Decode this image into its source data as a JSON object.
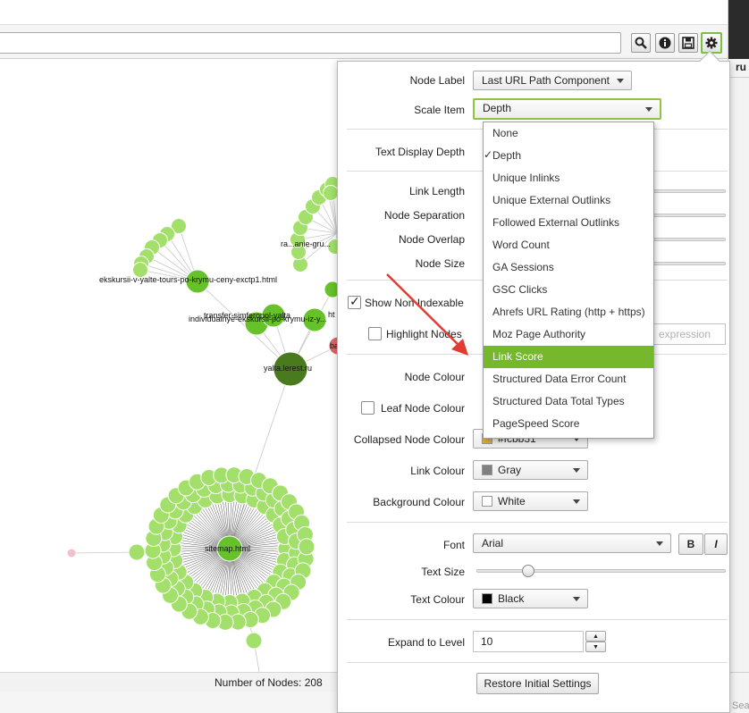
{
  "toolbar": {
    "search_value": "",
    "icons": [
      "search-icon",
      "info-icon",
      "save-icon",
      "gear-icon"
    ]
  },
  "right_strip": {
    "header_text": "ru",
    "search_placeholder": "Search..."
  },
  "graph": {
    "nodes": [
      {
        "label": "ekskursii-v-yalte-tours-po-krymu-ceny-exctp1.html"
      },
      {
        "label": "ra...anie-gru..."
      },
      {
        "label": "transfer-simferopol-yalta"
      },
      {
        "label": "individualnye-ekskursii-po-krymu-iz-y..."
      },
      {
        "label": "ht"
      },
      {
        "label": "ba"
      },
      {
        "label": "yalta.lerest.ru"
      },
      {
        "label": "sitemap.html"
      }
    ]
  },
  "status": {
    "node_count_text": "Number of Nodes: 208"
  },
  "settings": {
    "node_label": {
      "label": "Node Label",
      "value": "Last URL Path Component"
    },
    "scale_item": {
      "label": "Scale Item",
      "value": "Depth"
    },
    "text_display_depth": {
      "label": "Text Display Depth"
    },
    "link_length": {
      "label": "Link Length"
    },
    "node_separation": {
      "label": "Node Separation"
    },
    "node_overlap": {
      "label": "Node Overlap"
    },
    "node_size": {
      "label": "Node Size"
    },
    "show_non_indexable": {
      "label": "Show Non Indexable",
      "checked": true
    },
    "highlight_nodes": {
      "label": "Highlight Nodes",
      "checked": false,
      "placeholder": "expression"
    },
    "node_colour": {
      "label": "Node Colour"
    },
    "leaf_node_colour": {
      "label": "Leaf Node Colour",
      "checked": false
    },
    "collapsed_node_colour": {
      "label": "Collapsed Node Colour",
      "value": "#fcbb31",
      "swatch": "#e0b030"
    },
    "link_colour": {
      "label": "Link Colour",
      "value": "Gray",
      "swatch": "#808080"
    },
    "background_colour": {
      "label": "Background Colour",
      "value": "White",
      "swatch": "#ffffff"
    },
    "font": {
      "label": "Font",
      "value": "Arial",
      "bold": "B",
      "italic": "I"
    },
    "text_size": {
      "label": "Text Size"
    },
    "text_colour": {
      "label": "Text Colour",
      "value": "Black",
      "swatch": "#000000"
    },
    "expand_to_level": {
      "label": "Expand to Level",
      "value": "10"
    },
    "restore_button": "Restore Initial Settings"
  },
  "scale_dropdown": {
    "options": [
      "None",
      "Depth",
      "Unique Inlinks",
      "Unique External Outlinks",
      "Followed External Outlinks",
      "Word Count",
      "GA Sessions",
      "GSC Clicks",
      "Ahrefs URL Rating (http + https)",
      "Moz Page Authority",
      "Link Score",
      "Structured Data Error Count",
      "Structured Data Total Types",
      "PageSpeed Score"
    ],
    "checked": "Depth",
    "highlighted": "Link Score",
    "check_mark": "✓"
  },
  "colors": {
    "node_green": "#a3e06b",
    "node_dark": "#4a7a1e",
    "highlight": "#75b82c",
    "arrow": "#e03c31"
  }
}
